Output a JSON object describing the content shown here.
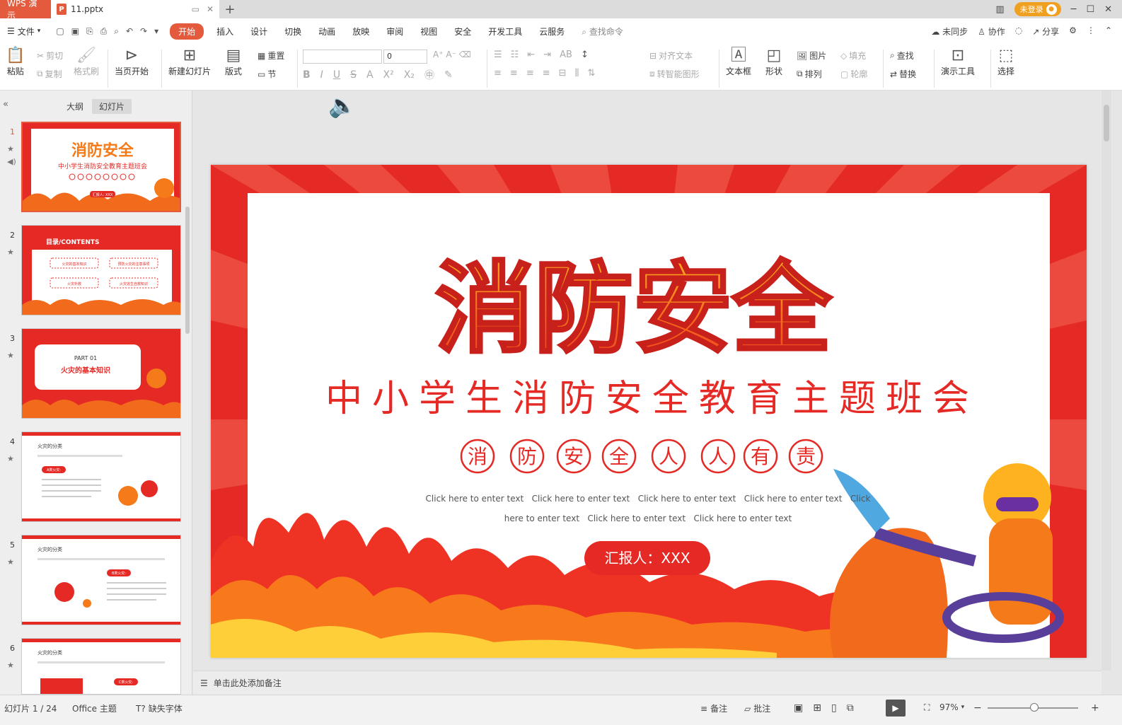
{
  "titlebar": {
    "app_tab": "WPS 演示",
    "doc_tab": "11.pptx",
    "new_tab": "+",
    "login": "未登录"
  },
  "menubar": {
    "file": "文件",
    "tabs": [
      "开始",
      "插入",
      "设计",
      "切换",
      "动画",
      "放映",
      "审阅",
      "视图",
      "安全",
      "开发工具",
      "云服务"
    ],
    "search": "查找命令",
    "sync": "未同步",
    "collab": "协作",
    "share": "分享"
  },
  "ribbon": {
    "paste": "粘贴",
    "cut": "剪切",
    "copy": "复制",
    "format_painter": "格式刷",
    "from_start": "当页开始",
    "new_slide": "新建幻灯片",
    "layout": "版式",
    "reset": "重置",
    "section": "节",
    "font_size": "0",
    "align_text": "对齐文本",
    "smart_art": "转智能图形",
    "textbox": "文本框",
    "shape": "形状",
    "picture": "图片",
    "arrange": "排列",
    "fill": "填充",
    "outline": "轮廓",
    "find": "查找",
    "replace": "替换",
    "present_tools": "演示工具",
    "select": "选择"
  },
  "sidebar": {
    "tab_outline": "大纲",
    "tab_slides": "幻灯片",
    "thumbs": [
      {
        "num": "1",
        "title": "消防安全",
        "subtitle": "中小学生消防安全教育主题班会",
        "reporter": "汇报人: XXX"
      },
      {
        "num": "2",
        "title": "目录/CONTENTS",
        "items": [
          "火灾的基本知识",
          "预防火灾的注意事项",
          "火灾扑救",
          "火灾逃生自救知识"
        ]
      },
      {
        "num": "3",
        "part": "PART 01",
        "title": "火灾的基本知识"
      },
      {
        "num": "4",
        "title": "火灾的分类",
        "tag": "A类火灾:"
      },
      {
        "num": "5",
        "title": "火灾的分类",
        "tag": "B类火灾:"
      },
      {
        "num": "6",
        "title": "火灾的分类",
        "tag": "C类火灾:"
      }
    ]
  },
  "slide": {
    "title": "消防安全",
    "subtitle": "中小学生消防安全教育主题班会",
    "circles": [
      "消",
      "防",
      "安",
      "全",
      "人",
      "人",
      "有",
      "责"
    ],
    "text_line1": "Click here to enter text   Click here to enter text   Click here to enter text   Click here to enter text   Click",
    "text_line2": "here to enter text   Click here to enter text   Click here to enter text",
    "reporter": "汇报人：XXX"
  },
  "notes": {
    "placeholder": "单击此处添加备注"
  },
  "status": {
    "slide_count": "幻灯片 1 / 24",
    "theme": "Office 主题",
    "missing_font": "缺失字体",
    "notes_btn": "备注",
    "comment_btn": "批注",
    "zoom": "97%"
  },
  "colors": {
    "accent": "#e35a3c",
    "slide_red": "#e52a26",
    "title_orange": "#f47a1a"
  }
}
